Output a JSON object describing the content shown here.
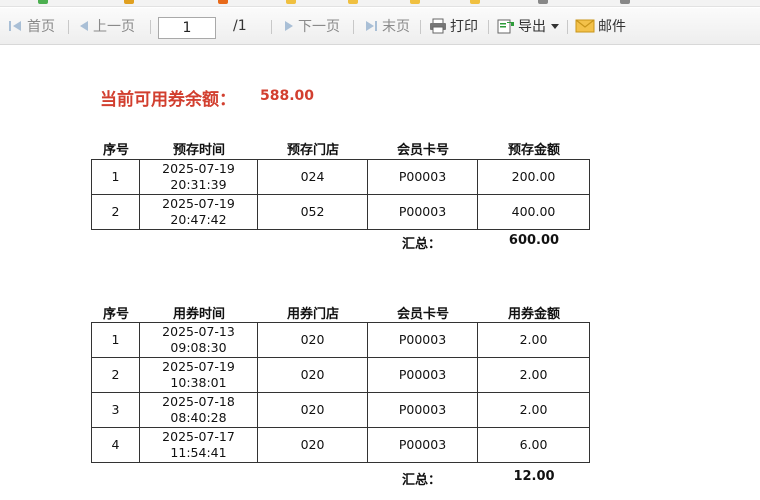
{
  "toolbar": {
    "first": "首页",
    "prev": "上一页",
    "page_value": "1",
    "page_total": "/1",
    "next": "下一页",
    "last": "末页",
    "print": "打印",
    "export": "导出",
    "mail": "邮件"
  },
  "balance": {
    "label": "当前可用券余额：",
    "value": "588.00"
  },
  "deposit": {
    "headers": [
      "序号",
      "预存时间",
      "预存门店",
      "会员卡号",
      "预存金额"
    ],
    "rows": [
      {
        "no": "1",
        "date": "2025-07-19",
        "time": "20:31:39",
        "store": "024",
        "card": "P00003",
        "amount": "200.00"
      },
      {
        "no": "2",
        "date": "2025-07-19",
        "time": "20:47:42",
        "store": "052",
        "card": "P00003",
        "amount": "400.00"
      }
    ],
    "total_label": "汇总：",
    "total_value": "600.00"
  },
  "usage": {
    "headers": [
      "序号",
      "用券时间",
      "用券门店",
      "会员卡号",
      "用券金额"
    ],
    "rows": [
      {
        "no": "1",
        "date": "2025-07-13",
        "time": "09:08:30",
        "store": "020",
        "card": "P00003",
        "amount": "2.00"
      },
      {
        "no": "2",
        "date": "2025-07-19",
        "time": "10:38:01",
        "store": "020",
        "card": "P00003",
        "amount": "2.00"
      },
      {
        "no": "3",
        "date": "2025-07-18",
        "time": "08:40:28",
        "store": "020",
        "card": "P00003",
        "amount": "2.00"
      },
      {
        "no": "4",
        "date": "2025-07-17",
        "time": "11:54:41",
        "store": "020",
        "card": "P00003",
        "amount": "6.00"
      }
    ],
    "total_label": "汇总：",
    "total_value": "12.00"
  }
}
